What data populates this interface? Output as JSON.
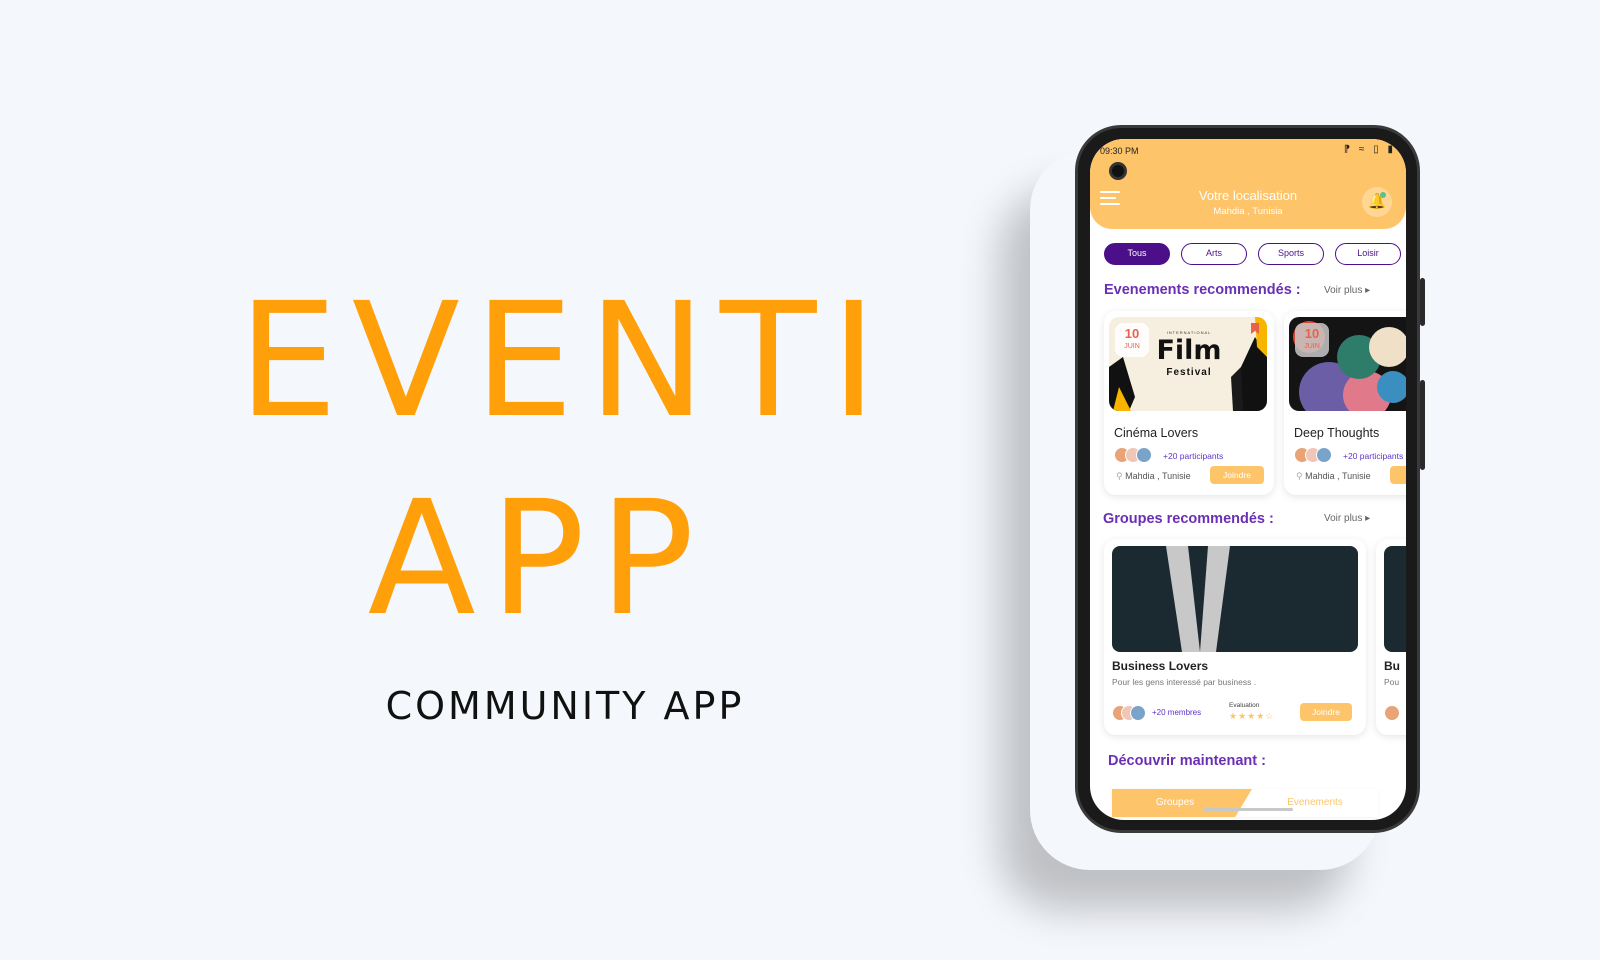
{
  "hero": {
    "title_line1": "EVENTI",
    "title_line2": "APP",
    "subtitle": "COMMUNITY APP"
  },
  "colors": {
    "accent": "#ff9f0a",
    "header": "#fec46a",
    "primary": "#4b0f8a",
    "section_title": "#6a2fb5",
    "background": "#f4f7fc"
  },
  "phone": {
    "status_bar": {
      "time": "09:30 PM",
      "icons": [
        "bluetooth-icon",
        "wifi-icon",
        "signal-icon",
        "battery-icon"
      ]
    },
    "header": {
      "location_title": "Votre localisation",
      "location_value": "Mahdia , Tunisia",
      "menu_icon": "hamburger-menu-icon",
      "bell_icon": "notification-bell-icon"
    },
    "filters": [
      {
        "label": "Tous",
        "active": true
      },
      {
        "label": "Arts",
        "active": false
      },
      {
        "label": "Sports",
        "active": false
      },
      {
        "label": "Loisir",
        "active": false
      }
    ],
    "events_section": {
      "title": "Evenements recommendés :",
      "see_more": "Voir plus ▸",
      "cards": [
        {
          "day": "10",
          "month": "JUIN",
          "poster_small": "INTERNATIONAL",
          "poster_big": "Film",
          "poster_sub": "Festival",
          "name": "Cinéma Lovers",
          "participants": "+20 participants",
          "location": "Mahdia , Tunisie",
          "join": "Joindre"
        },
        {
          "day": "10",
          "month": "JUIN",
          "name": "Deep Thoughts",
          "participants": "+20 participants",
          "location": "Mahdia , Tunisie"
        }
      ]
    },
    "groups_section": {
      "title": "Groupes recommendés :",
      "see_more": "Voir plus ▸",
      "cards": [
        {
          "name": "Business Lovers",
          "description": "Pour les gens interessé par business .",
          "members": "+20 membres",
          "evaluation_label": "Evaluation",
          "rating": 4,
          "rating_max": 5,
          "stars": "★★★★☆",
          "join": "Joindre"
        },
        {
          "name": "Bu",
          "description": "Pou"
        }
      ]
    },
    "discover": {
      "title": "Découvrir maintenant :",
      "tabs": [
        {
          "label": "Groupes",
          "active": true
        },
        {
          "label": "Evenements",
          "active": false
        }
      ]
    }
  }
}
